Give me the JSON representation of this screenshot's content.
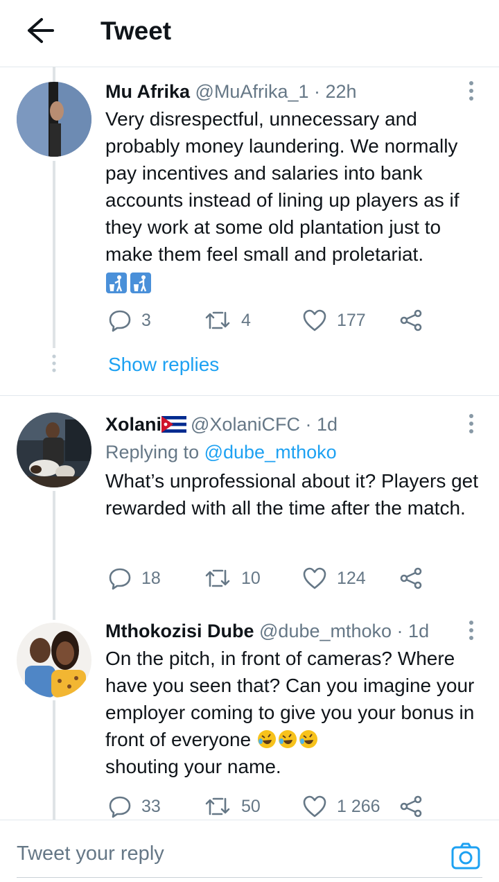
{
  "header": {
    "title": "Tweet"
  },
  "tweets": [
    {
      "name": "Mu Afrika",
      "handle": "@MuAfrika_1",
      "sep": " · ",
      "time": "22h",
      "text": "Very disrespectful, unnecessary and probably money laundering. We normally pay incentives and salaries into bank accounts instead of lining up players as if they work at some old plantation just to make them feel small and proletariat.",
      "emojis": [
        "put-litter-in-its-place",
        "put-litter-in-its-place"
      ],
      "replies": "3",
      "retweets": "4",
      "likes": "177"
    },
    {
      "name": "Xolani",
      "flag": "cuba-flag",
      "handle": "@XolaniCFC",
      "sep": " · ",
      "time": "1d",
      "replying_prefix": "Replying to ",
      "replying_to": "@dube_mthoko",
      "text": "What’s unprofessional about it? Players get rewarded with all the time after the match.",
      "replies": "18",
      "retweets": "10",
      "likes": "124"
    },
    {
      "name": "Mthokozisi Dube",
      "handle": "@dube_mthoko",
      "sep": " · ",
      "time": "1d",
      "text_before": "On the pitch, in front of cameras? Where have you seen that? Can you imagine your employer coming to give you your bonus in front of everyone ",
      "emojis": [
        "rolling-on-the-floor-laughing",
        "rolling-on-the-floor-laughing",
        "rolling-on-the-floor-laughing"
      ],
      "text_after": "shouting your name.",
      "replies": "33",
      "retweets": "50",
      "likes": "1 266"
    }
  ],
  "show_replies": "Show replies",
  "reply_bar": {
    "placeholder": "Tweet your reply",
    "icon": "camera-icon"
  },
  "colors": {
    "link": "#1da1f2",
    "muted": "#657786",
    "text": "#0f1419",
    "divider": "#e1e8ed"
  }
}
